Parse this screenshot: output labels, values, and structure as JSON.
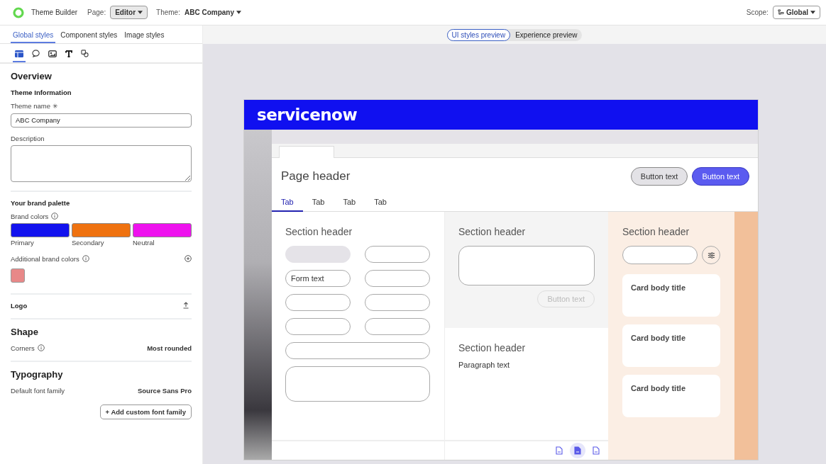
{
  "topbar": {
    "app_title": "Theme Builder",
    "page_label": "Page:",
    "page_value": "Editor",
    "theme_label": "Theme:",
    "theme_value": "ABC Company",
    "scope_label": "Scope:",
    "scope_value": "Global"
  },
  "panel_tabs": [
    {
      "label": "Global styles",
      "selected": true
    },
    {
      "label": "Component styles",
      "selected": false
    },
    {
      "label": "Image styles",
      "selected": false
    }
  ],
  "tool_icons": [
    {
      "kind": "layout",
      "selected": true
    },
    {
      "kind": "chat",
      "selected": false
    },
    {
      "kind": "image",
      "selected": false
    },
    {
      "kind": "text",
      "selected": false
    },
    {
      "kind": "shapes",
      "selected": false
    }
  ],
  "overview": {
    "heading": "Overview",
    "subheading": "Theme Information",
    "name_label": "Theme name",
    "required_mark": "✳",
    "name_value": "ABC Company",
    "description_label": "Description"
  },
  "brand": {
    "heading": "Your brand palette",
    "colors_label": "Brand colors",
    "swatches": [
      {
        "label": "Primary",
        "color": "#1212ee"
      },
      {
        "label": "Secondary",
        "color": "#ef7210"
      },
      {
        "label": "Neutral",
        "color": "#ee12ee"
      }
    ],
    "additional_label": "Additional brand colors",
    "additional_swatches": [
      {
        "color": "#e88888"
      }
    ]
  },
  "logo": {
    "label": "Logo"
  },
  "shape": {
    "heading": "Shape",
    "corners_label": "Corners",
    "corners_value": "Most rounded"
  },
  "typography": {
    "heading": "Typography",
    "font_label": "Default font family",
    "font_value": "Source Sans Pro",
    "add_button": "+ Add custom font family"
  },
  "preview_toggle": [
    {
      "label": "UI styles preview",
      "selected": true
    },
    {
      "label": "Experience preview",
      "selected": false
    }
  ],
  "preview": {
    "logo": "servicenow",
    "page_header": "Page header",
    "header_buttons": [
      {
        "label": "Button text",
        "kind": "secondary"
      },
      {
        "label": "Button text",
        "kind": "primary"
      }
    ],
    "tabs": [
      {
        "label": "Tab",
        "selected": true
      },
      {
        "label": "Tab",
        "selected": false
      },
      {
        "label": "Tab",
        "selected": false
      },
      {
        "label": "Tab",
        "selected": false
      }
    ],
    "column_1": {
      "header": "Section header",
      "fields": [
        {
          "kind": "disabled"
        },
        {
          "kind": "input"
        },
        {
          "kind": "input",
          "value": "Form text"
        },
        {
          "kind": "input"
        },
        {
          "kind": "input"
        },
        {
          "kind": "input"
        },
        {
          "kind": "input"
        },
        {
          "kind": "input"
        },
        {
          "kind": "wide_input"
        },
        {
          "kind": "textarea"
        }
      ]
    },
    "column_2": {
      "header": "Section header",
      "button": {
        "label": "Button text",
        "disabled": true
      },
      "header_2": "Section header",
      "paragraph": "Paragraph text"
    },
    "column_3": {
      "header": "Section header",
      "cards": [
        {
          "title": "Card body title"
        },
        {
          "title": "Card body title"
        },
        {
          "title": "Card body title"
        }
      ]
    },
    "page_icons": [
      {
        "selected": false
      },
      {
        "selected": true
      },
      {
        "selected": false
      }
    ]
  }
}
